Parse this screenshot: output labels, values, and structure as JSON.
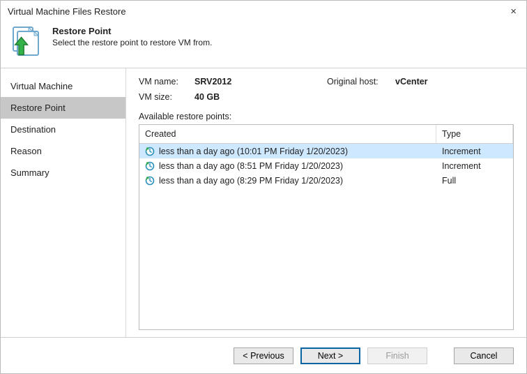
{
  "window": {
    "title": "Virtual Machine Files Restore"
  },
  "header": {
    "title": "Restore Point",
    "subtitle": "Select the restore point to restore VM from."
  },
  "sidebar": {
    "items": [
      {
        "label": "Virtual Machine",
        "active": false
      },
      {
        "label": "Restore Point",
        "active": true
      },
      {
        "label": "Destination",
        "active": false
      },
      {
        "label": "Reason",
        "active": false
      },
      {
        "label": "Summary",
        "active": false
      }
    ]
  },
  "info": {
    "vm_name_label": "VM name:",
    "vm_name_value": "SRV2012",
    "host_label": "Original host:",
    "host_value": "vCenter",
    "vm_size_label": "VM size:",
    "vm_size_value": "40 GB"
  },
  "table": {
    "caption": "Available restore points:",
    "columns": {
      "created": "Created",
      "type": "Type"
    },
    "rows": [
      {
        "created": "less than a day ago (10:01 PM Friday 1/20/2023)",
        "type": "Increment",
        "selected": true
      },
      {
        "created": "less than a day ago (8:51 PM Friday 1/20/2023)",
        "type": "Increment",
        "selected": false
      },
      {
        "created": "less than a day ago (8:29 PM Friday 1/20/2023)",
        "type": "Full",
        "selected": false
      }
    ]
  },
  "buttons": {
    "previous": "< Previous",
    "next": "Next >",
    "finish": "Finish",
    "cancel": "Cancel"
  }
}
